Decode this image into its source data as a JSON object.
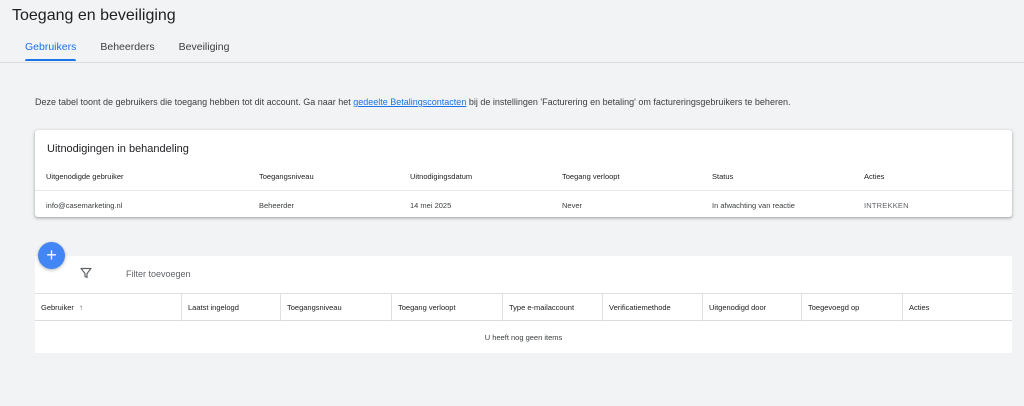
{
  "page": {
    "title": "Toegang en beveiliging"
  },
  "tabs": [
    {
      "label": "Gebruikers",
      "active": true
    },
    {
      "label": "Beheerders",
      "active": false
    },
    {
      "label": "Beveiliging",
      "active": false
    }
  ],
  "intro": {
    "before": "Deze tabel toont de gebruikers die toegang hebben tot dit account. Ga naar het ",
    "link": "gedeelte Betalingscontacten",
    "after": " bij de instellingen 'Facturering en betaling' om factureringsgebruikers te beheren."
  },
  "invitations": {
    "title": "Uitnodigingen in behandeling",
    "columns": [
      "Uitgenodigde gebruiker",
      "Toegangsniveau",
      "Uitnodigingsdatum",
      "Toegang verloopt",
      "Status",
      "Acties"
    ],
    "rows": [
      {
        "user": "info@casemarketing.nl",
        "level": "Beheerder",
        "date": "14 mei 2025",
        "expires": "Never",
        "status": "In afwachting van reactie",
        "action": "INTREKKEN"
      }
    ]
  },
  "users_table": {
    "add_button": "+",
    "filter_placeholder": "Filter toevoegen",
    "columns": [
      "Gebruiker",
      "Laatst ingelogd",
      "Toegangsniveau",
      "Toegang verloopt",
      "Type e-mailaccount",
      "Verificatiemethode",
      "Uitgenodigd door",
      "Toegevoegd op",
      "Acties"
    ],
    "sort_indicator": "↑",
    "empty_message": "U heeft nog geen items"
  },
  "colors": {
    "accent": "#1a73e8",
    "fab": "#4285f4",
    "background": "#f1f3f4"
  }
}
